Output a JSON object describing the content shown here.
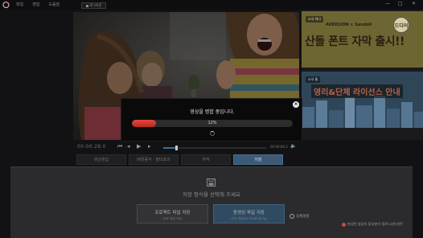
{
  "menu": [
    "파일",
    "편집",
    "도움말"
  ],
  "login_label": "로그아웃",
  "window_controls": [
    "—",
    "□",
    "✕"
  ],
  "ads": [
    {
      "tag": "소식 하나",
      "brand": "AVERSION × Sandoll",
      "title": "산돌 폰트 자막 출시!!",
      "badge": "드디어"
    },
    {
      "tag": "소식 둘",
      "title": "영리&단체 라이선스 안내"
    }
  ],
  "player": {
    "current_time": "00:00:28.0",
    "total_time": "00:00:06.5",
    "progress": 0.12
  },
  "tabs": [
    {
      "label": "영상편집",
      "active": false
    },
    {
      "label": "배경음악 · 필터효과",
      "active": false
    },
    {
      "label": "자막",
      "active": false
    },
    {
      "label": "저장",
      "active": true
    }
  ],
  "save": {
    "title": "저장 형식을 선택해 주세요",
    "project_btn": {
      "label": "프로젝트 파일 저장",
      "sub": "(추후 편집 가능)"
    },
    "video_btn": {
      "label": "동영상 파일 저장",
      "sub": "(추후 편집에서 재사용 불가능)"
    },
    "detail_label": "상세설정",
    "help_text": "완성된 영상의 탑부분이 잘려 나온다면?"
  },
  "modal": {
    "title": "영상을 병합 중입니다.",
    "percent_label": "12%",
    "percent": 0.12
  },
  "colors": {
    "accent": "#3c5a76",
    "progress": "#d23a2e"
  }
}
